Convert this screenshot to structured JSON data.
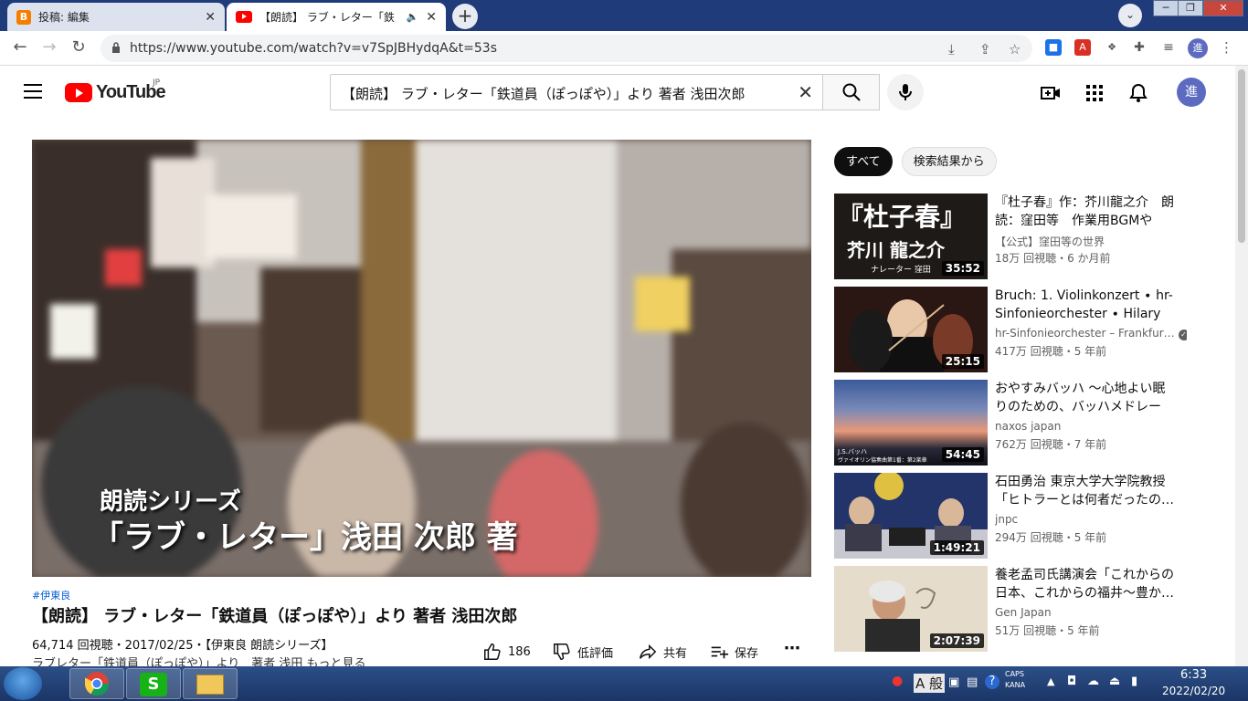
{
  "browser": {
    "tabs": [
      {
        "title": "投稿: 編集",
        "active": false
      },
      {
        "title": "【朗読】 ラブ・レター「鉄",
        "active": true
      }
    ],
    "url": "https://www.youtube.com/watch?v=v7SpJBHydqA&t=53s",
    "profile_initial": "進"
  },
  "youtube": {
    "logo_text": "YouTube",
    "region": "JP",
    "search_query": "【朗読】 ラブ・レター「鉄道員（ぽっぽや）」より 著者 浅田次郎",
    "avatar_initial": "進"
  },
  "video": {
    "caption_line1": "朗読シリーズ",
    "caption_line2": "「ラブ・レター」浅田 次郎 著",
    "hashtag": "#伊東良",
    "title": "【朗読】 ラブ・レター「鉄道員（ぽっぽや）」より 著者 浅田次郎",
    "meta": "64,714 回視聴・2017/02/25・【伊東良 朗読シリーズ】",
    "description": "ラブレター「鉄道員（ぽっぽや）」より　著者 浅田",
    "more": "もっと見る",
    "likes": "186",
    "dislike_label": "低評価",
    "share_label": "共有",
    "save_label": "保存"
  },
  "chips": [
    "すべて",
    "検索結果から"
  ],
  "recommendations": [
    {
      "title": "『杜子春』作：芥川龍之介　朗読：窪田等　作業用BGMや睡…",
      "channel": "【公式】窪田等の世界",
      "stats": "18万 回視聴・6 か月前",
      "duration": "35:52",
      "thumb_text1": "『杜子春』",
      "thumb_text2": "芥川 龍之介",
      "thumb_text3": "ナレーター 窪田"
    },
    {
      "title": "Bruch: 1. Violinkonzert ∙ hr-Sinfonieorchester ∙ Hilary Hah…",
      "channel": "hr-Sinfonieorchester – Frankfur…",
      "stats": "417万 回視聴・5 年前",
      "duration": "25:15"
    },
    {
      "title": "おやすみバッハ ～心地よい眠りのための、バッハメドレー～…",
      "channel": "naxos japan",
      "stats": "762万 回視聴・7 年前",
      "duration": "54:45",
      "thumb_text1": "J.S.バッハ",
      "thumb_text2": "ヴァイオリン協奏曲第1番：第2楽章"
    },
    {
      "title": "石田勇治 東京大学大学院教授「ヒトラーとは何者だったの…",
      "channel": "jnpc",
      "stats": "294万 回視聴・5 年前",
      "duration": "1:49:21"
    },
    {
      "title": "養老孟司氏講演会「これからの日本、これからの福井～豊か…",
      "channel": "Gen Japan",
      "stats": "51万 回視聴・5 年前",
      "duration": "2:07:39"
    }
  ],
  "taskbar": {
    "ime_label": "A 般",
    "caps": "CAPS",
    "kana": "KANA",
    "time": "6:33",
    "date": "2022/02/20"
  }
}
